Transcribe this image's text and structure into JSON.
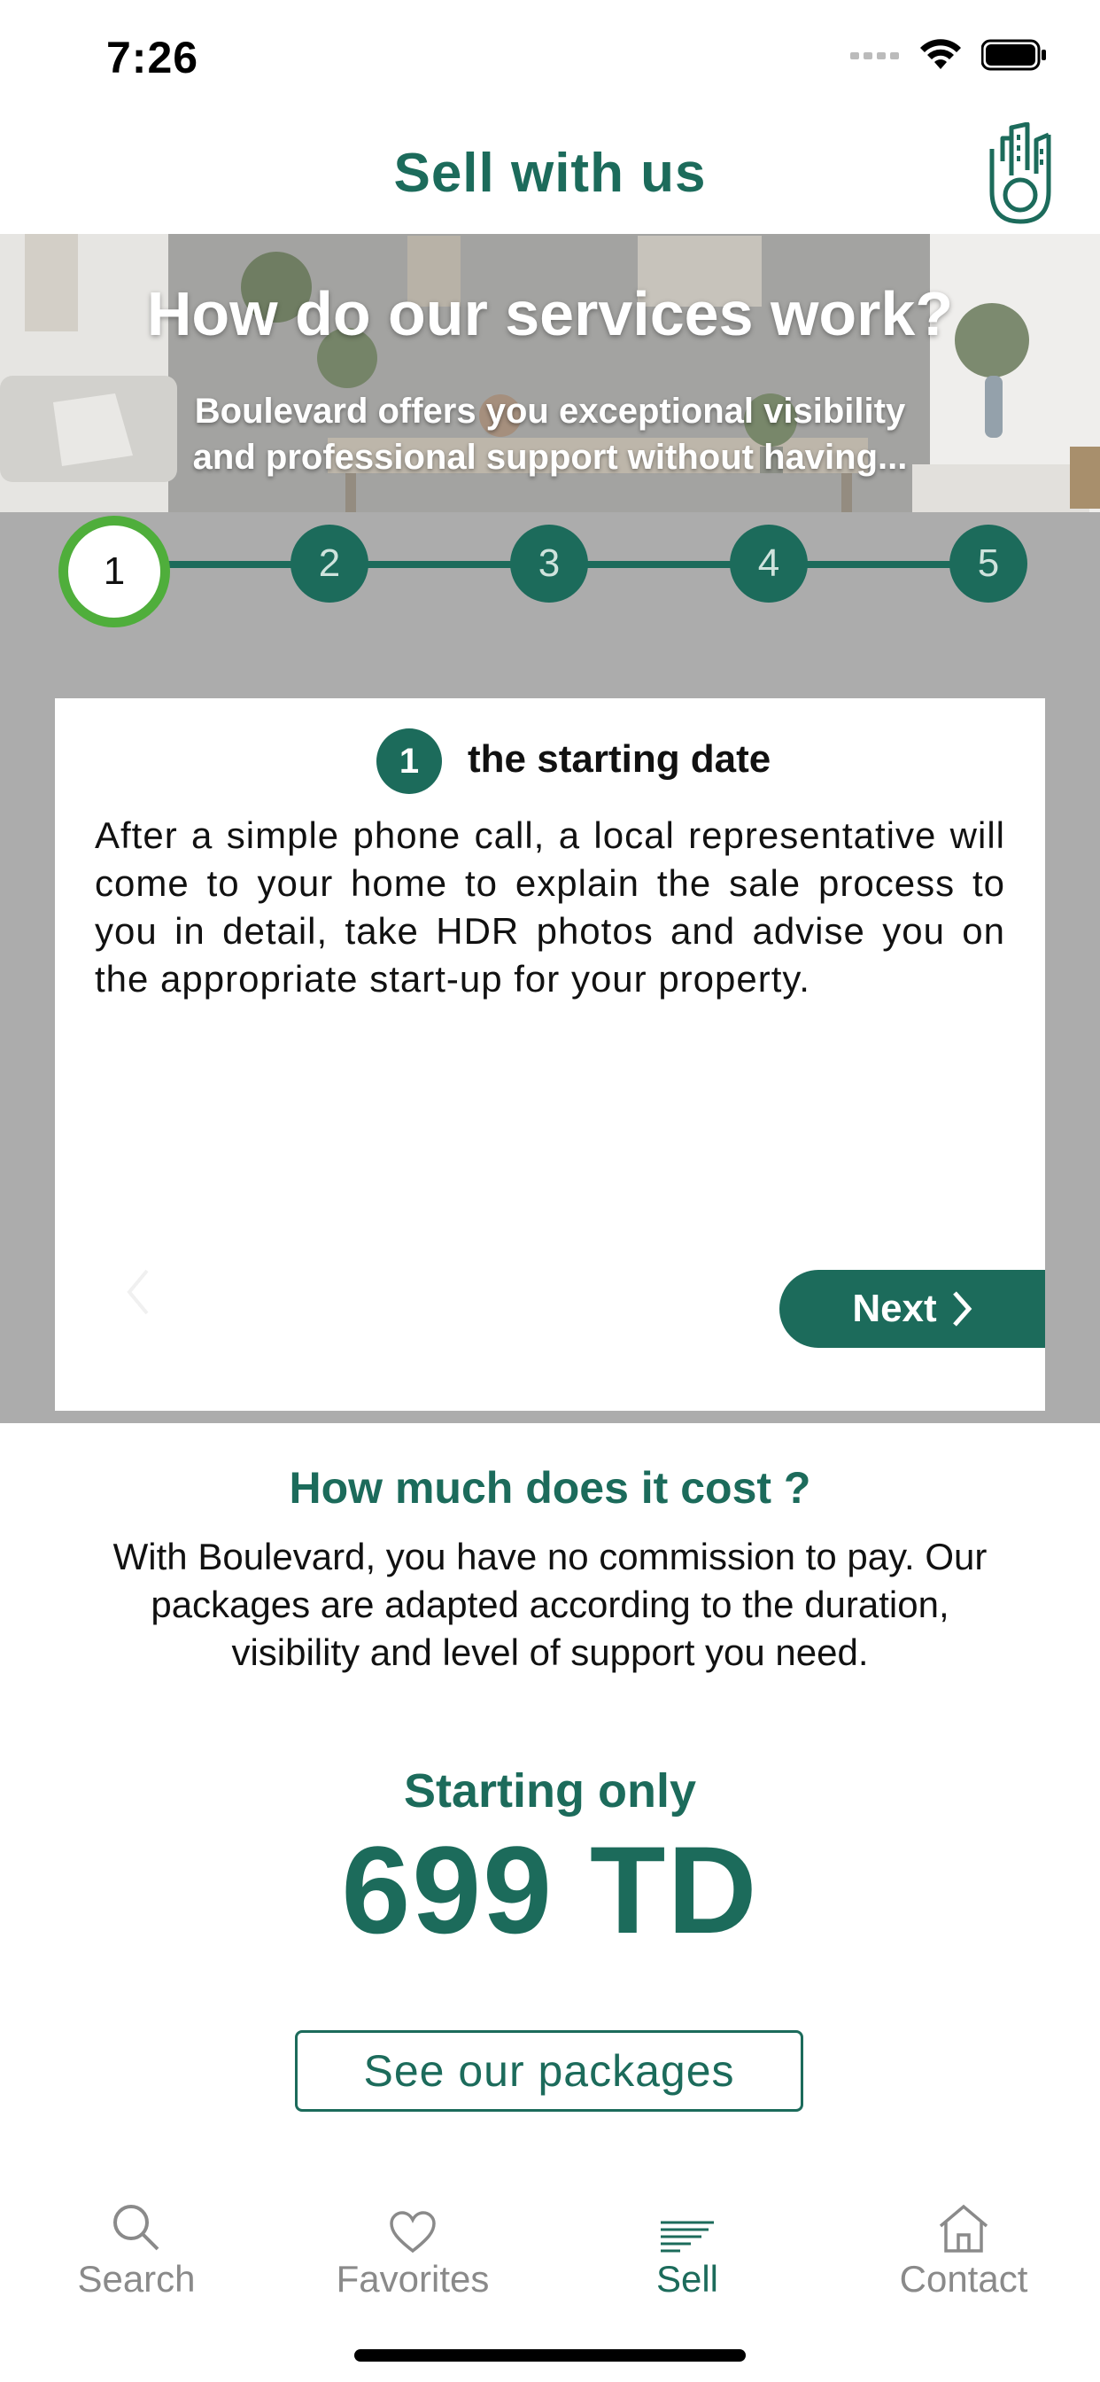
{
  "status_bar": {
    "time": "7:26"
  },
  "header": {
    "title": "Sell with us"
  },
  "hero": {
    "title": "How do our services work?",
    "subtitle_line1": "Boulevard offers you exceptional visibility",
    "subtitle_line2": "and professional support without having..."
  },
  "steps": [
    {
      "number": "1",
      "active": true
    },
    {
      "number": "2",
      "active": false
    },
    {
      "number": "3",
      "active": false
    },
    {
      "number": "4",
      "active": false
    },
    {
      "number": "5",
      "active": false
    }
  ],
  "card": {
    "badge": "1",
    "title": "the starting date",
    "text": "After a simple phone call, a local representative will come to your home to explain the sale process to you in detail, take HDR photos and advise you on the appropriate start-up for your property.",
    "next_label": "Next"
  },
  "cost": {
    "title": "How much does it cost ?",
    "text": "With Boulevard, you have no commission to pay. Our packages are adapted according to the duration, visibility and level of support you need.",
    "starting_label": "Starting only",
    "price": "699 TD",
    "packages_button": "See our packages"
  },
  "tabs": [
    {
      "label": "Search",
      "icon": "search-icon",
      "active": false
    },
    {
      "label": "Favorites",
      "icon": "heart-icon",
      "active": false
    },
    {
      "label": "Sell",
      "icon": "sell-lines-icon",
      "active": true
    },
    {
      "label": "Contact",
      "icon": "home-icon",
      "active": false
    }
  ],
  "colors": {
    "brand": "#1c6b5b",
    "active_ring": "#4fae3b",
    "step_bg": "#acacac"
  }
}
